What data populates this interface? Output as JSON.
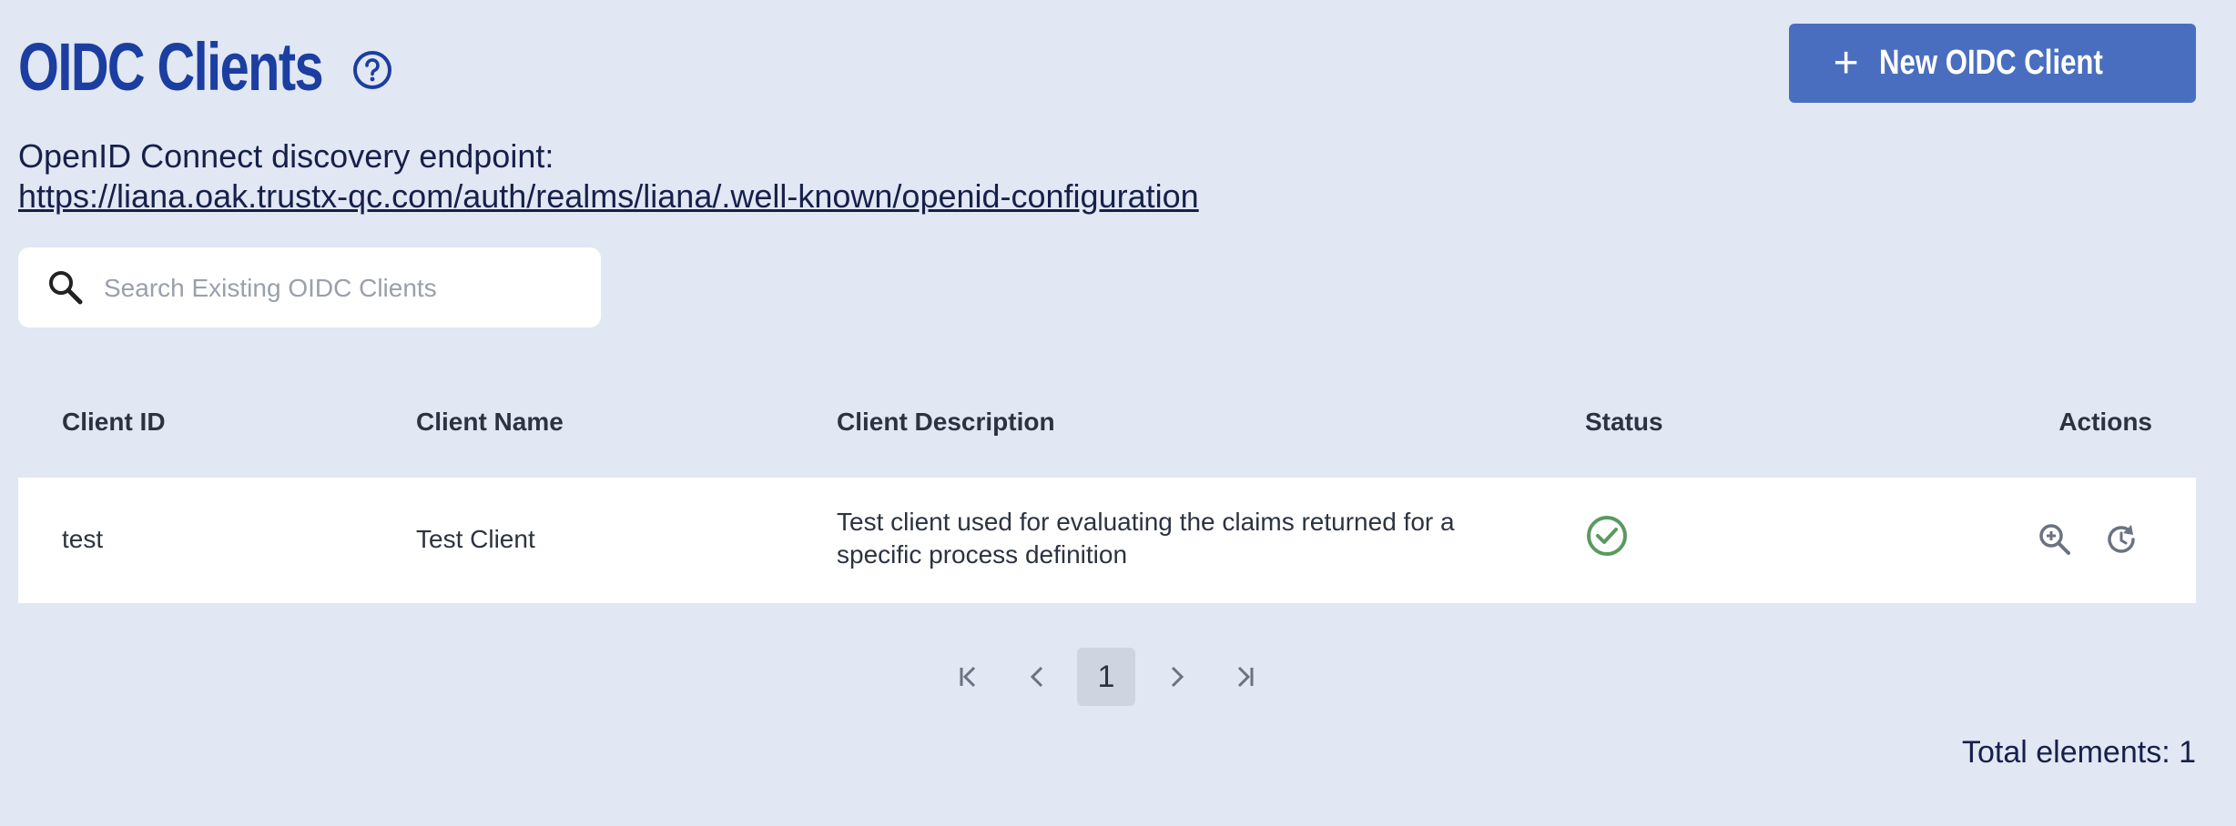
{
  "header": {
    "title": "OIDC Clients",
    "help_icon": "question-circle-icon",
    "new_button_label": "New OIDC Client",
    "new_button_icon": "plus-icon"
  },
  "discovery": {
    "label": "OpenID Connect discovery endpoint:",
    "url": "https://liana.oak.trustx-qc.com/auth/realms/liana/.well-known/openid-configuration"
  },
  "search": {
    "placeholder": "Search Existing OIDC Clients",
    "value": "",
    "icon": "search-icon"
  },
  "table": {
    "columns": [
      "Client ID",
      "Client Name",
      "Client Description",
      "Status",
      "Actions"
    ],
    "rows": [
      {
        "client_id": "test",
        "client_name": "Test Client",
        "description": "Test client used for evaluating the claims returned for a specific process definition",
        "status": "active",
        "status_icon": "check-circle-icon",
        "actions": [
          "zoom-in-icon",
          "reset-icon"
        ]
      }
    ]
  },
  "pagination": {
    "current_page": "1",
    "icons": [
      "first-page-icon",
      "prev-page-icon",
      "next-page-icon",
      "last-page-icon"
    ]
  },
  "footer": {
    "total_text": "Total elements: 1"
  },
  "colors": {
    "background": "#e1e7f3",
    "title": "#1b3ea0",
    "primary_button": "#4a6ebf",
    "status_active": "#5a9a5e"
  }
}
